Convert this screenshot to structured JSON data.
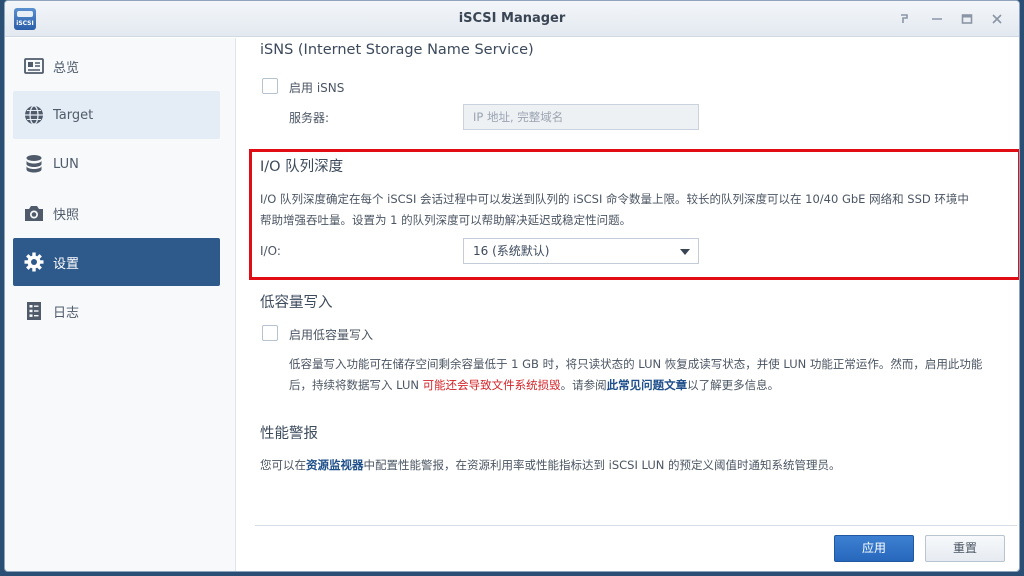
{
  "window": {
    "title": "iSCSI Manager",
    "app_icon_text": "iSCSI"
  },
  "sidebar": {
    "items": [
      {
        "label": "总览",
        "icon": "overview-icon"
      },
      {
        "label": "Target",
        "icon": "globe-icon"
      },
      {
        "label": "LUN",
        "icon": "database-icon"
      },
      {
        "label": "快照",
        "icon": "camera-icon"
      },
      {
        "label": "设置",
        "icon": "gear-icon"
      },
      {
        "label": "日志",
        "icon": "log-icon"
      }
    ],
    "hovered": "Target",
    "active": "设置"
  },
  "isns": {
    "title": "iSNS (Internet Storage Name Service)",
    "enable_label": "启用 iSNS",
    "enable_checked": false,
    "server_label": "服务器:",
    "server_placeholder": "IP 地址, 完整域名"
  },
  "io_queue": {
    "title": "I/O 队列深度",
    "desc_line1": "I/O 队列深度确定在每个 iSCSI 会话过程中可以发送到队列的 iSCSI 命令数量上限。较长的队列深度可以在 10/40 GbE 网络和 SSD 环境中",
    "desc_line2": "帮助增强吞吐量。设置为 1 的队列深度可以帮助解决延迟或稳定性问题。",
    "io_label": "I/O:",
    "io_value": "16 (系统默认)"
  },
  "low_capacity": {
    "title": "低容量写入",
    "enable_label": "启用低容量写入",
    "enable_checked": false,
    "desc_line1": "低容量写入功能可在储存空间剩余容量低于 1 GB 时，将只读状态的 LUN 恢复成读写状态，并使 LUN 功能正常运作。然而，启用此功能",
    "desc_line2_a": "后，持续将数据写入 LUN ",
    "desc_line2_warning": "可能还会导致文件系统损毁",
    "desc_line2_b": "。请参阅",
    "desc_line2_link": "此常见问题文章",
    "desc_line2_c": "以了解更多信息。"
  },
  "perf_alert": {
    "title": "性能警报",
    "desc_a": "您可以在",
    "desc_link": "资源监视器",
    "desc_b": "中配置性能警报，在资源利用率或性能指标达到 iSCSI LUN 的预定义阈值时通知系统管理员。"
  },
  "footer": {
    "apply_label": "应用",
    "reset_label": "重置"
  },
  "colors": {
    "active_nav": "#2e5a8b",
    "primary_button": "#2768bd",
    "highlight": "#e00d14",
    "warning_text": "#d3242a",
    "link": "#1e4f8a"
  }
}
